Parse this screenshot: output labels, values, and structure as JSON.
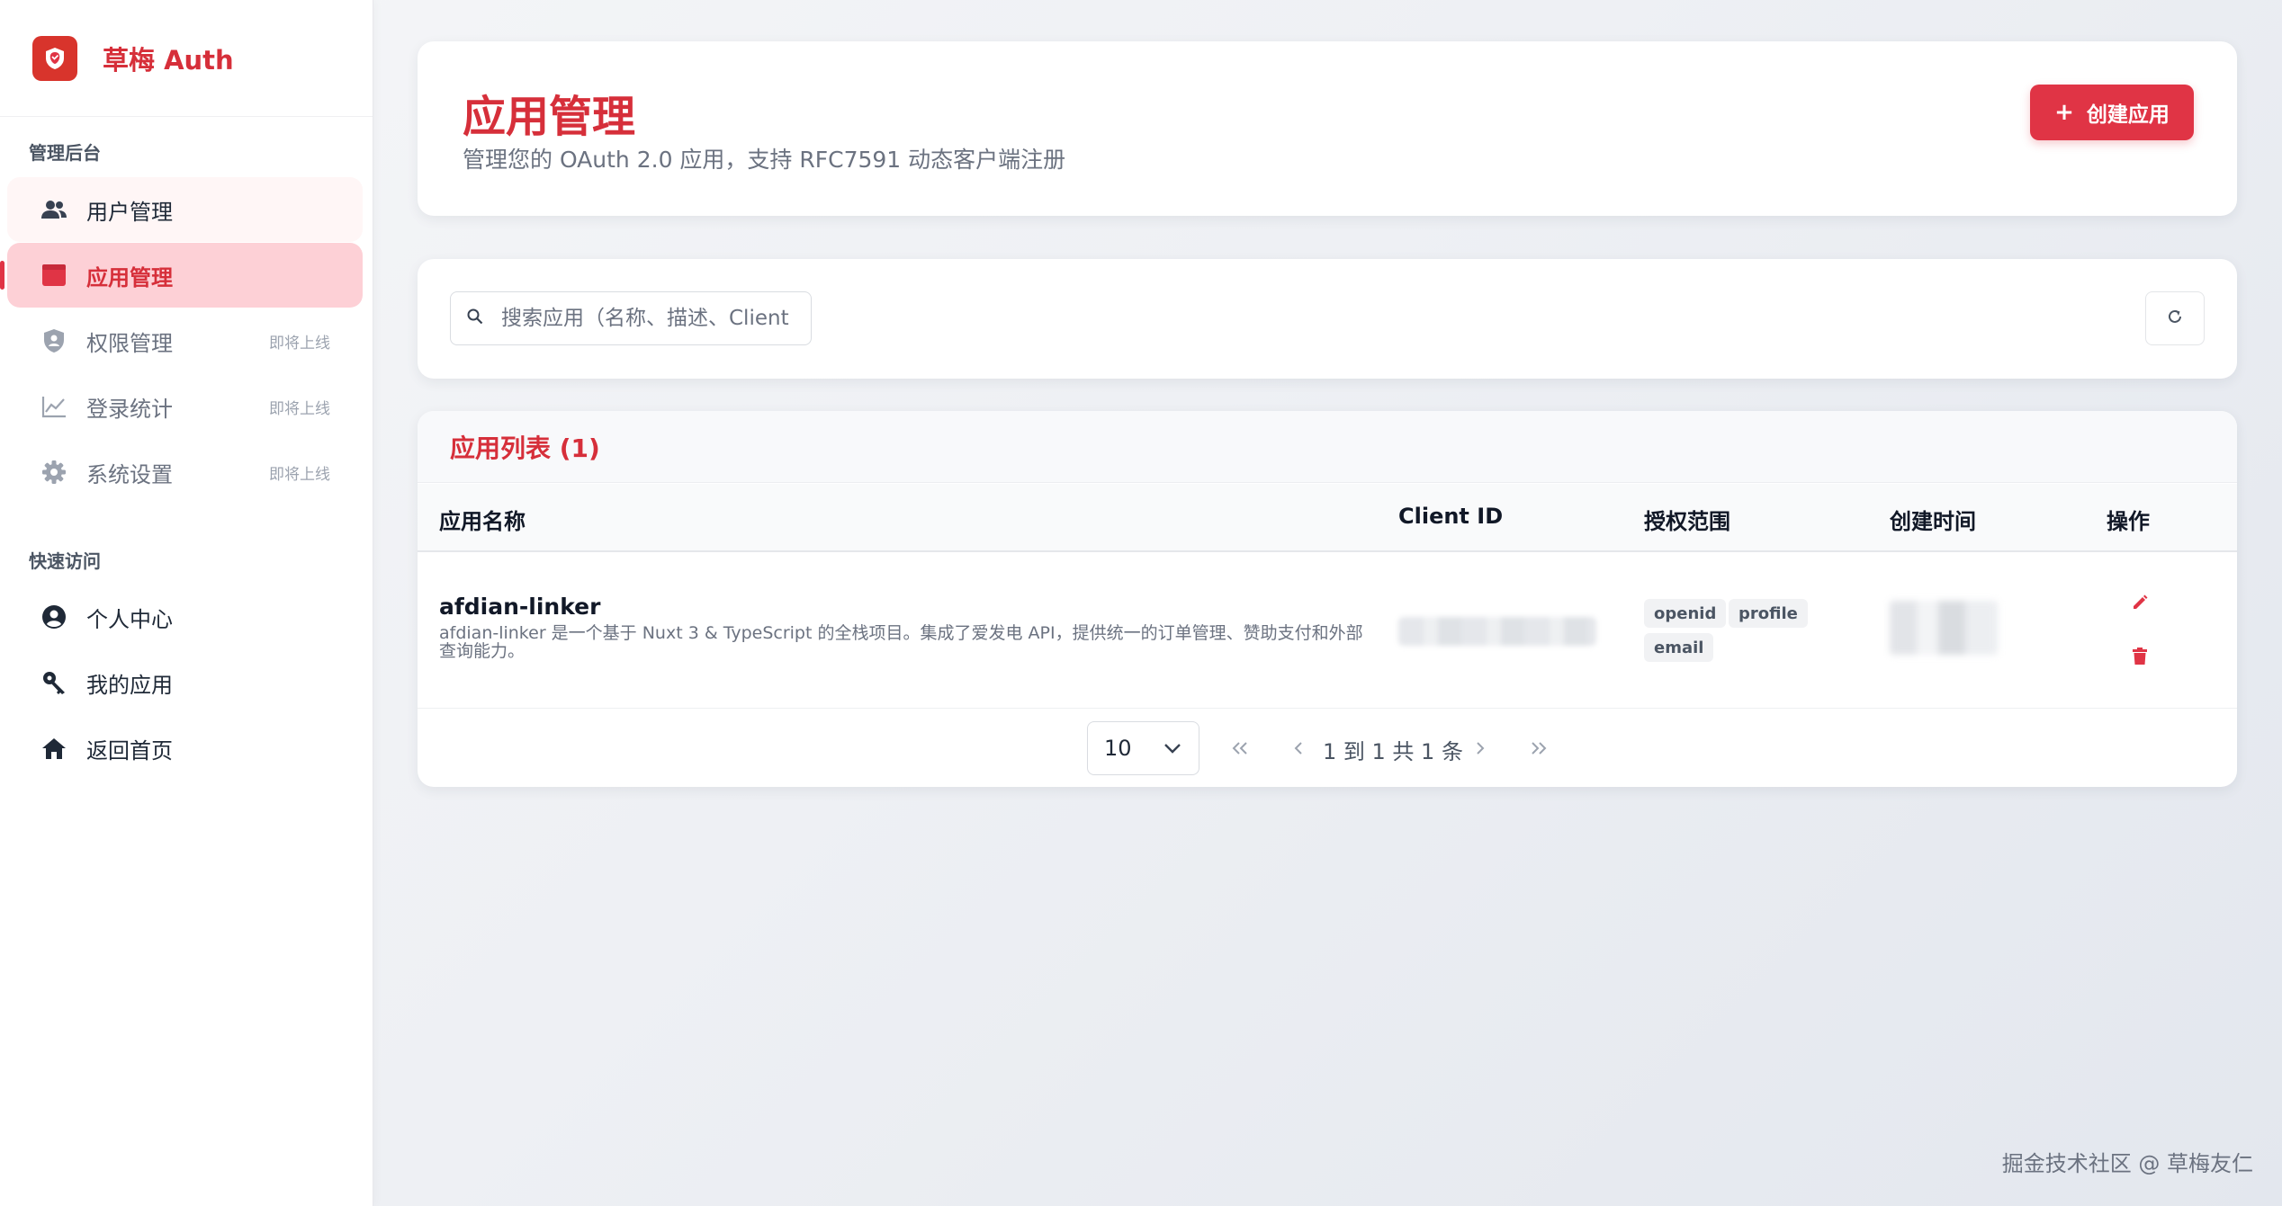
{
  "brand": {
    "name": "草梅 Auth"
  },
  "sidebar": {
    "admin_section": "管理后台",
    "admin_items": [
      {
        "label": "用户管理",
        "icon": "users-icon",
        "badge": ""
      },
      {
        "label": "应用管理",
        "icon": "app-icon",
        "badge": "",
        "active": true
      },
      {
        "label": "权限管理",
        "icon": "shield-icon",
        "badge": "即将上线"
      },
      {
        "label": "登录统计",
        "icon": "chart-line-icon",
        "badge": "即将上线"
      },
      {
        "label": "系统设置",
        "icon": "gear-icon",
        "badge": "即将上线"
      }
    ],
    "quick_section": "快速访问",
    "quick_items": [
      {
        "label": "个人中心",
        "icon": "user-circle-icon"
      },
      {
        "label": "我的应用",
        "icon": "key-icon"
      },
      {
        "label": "返回首页",
        "icon": "home-icon"
      }
    ]
  },
  "header": {
    "title": "应用管理",
    "subtitle": "管理您的 OAuth 2.0 应用，支持 RFC7591 动态客户端注册",
    "create_label": "创建应用"
  },
  "search": {
    "placeholder": "搜索应用（名称、描述、Client ID）",
    "value": ""
  },
  "list": {
    "title": "应用列表 (1)",
    "columns": [
      "应用名称",
      "Client ID",
      "授权范围",
      "创建时间",
      "操作"
    ],
    "rows": [
      {
        "name": "afdian-linker",
        "description": "afdian-linker 是一个基于 Nuxt 3 & TypeScript 的全栈项目。集成了爱发电 API，提供统一的订单管理、赞助支付和外部查询能力。",
        "scopes": [
          "openid",
          "profile",
          "email"
        ]
      }
    ]
  },
  "pagination": {
    "page_size": "10",
    "info": "1 到 1 共 1 条"
  },
  "colors": {
    "accent": "#e03445",
    "accent_text": "#d62f3a",
    "active_bg": "#fdd0d6"
  },
  "watermark": "掘金技术社区 @ 草梅友仁"
}
